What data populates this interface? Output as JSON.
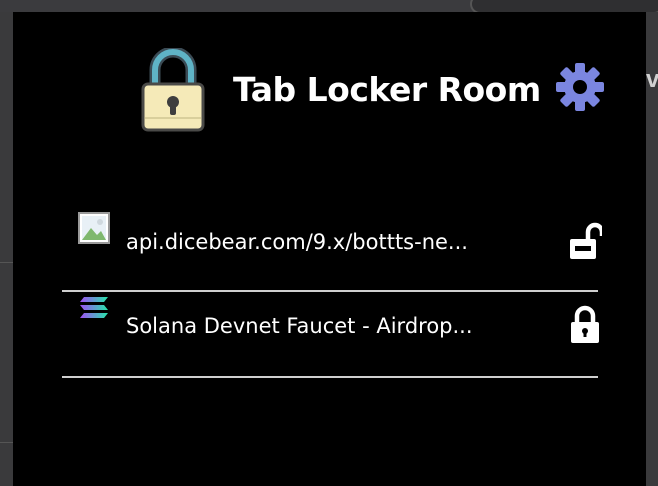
{
  "app": {
    "title": "Tab Locker Room",
    "logo_icon": "padlock-icon",
    "settings_icon": "gear-icon",
    "settings_color": "#7b86e0"
  },
  "background": {
    "partial_text": "ve"
  },
  "tabs": [
    {
      "title": "api.dicebear.com/9.x/bottts-ne...",
      "favicon": "image-placeholder-icon",
      "lock_state": "unlocked",
      "lock_icon": "unlocked-lock-icon"
    },
    {
      "title": "Solana Devnet Faucet - Airdrop...",
      "favicon": "solana-icon",
      "lock_state": "locked",
      "lock_icon": "locked-lock-icon"
    }
  ]
}
